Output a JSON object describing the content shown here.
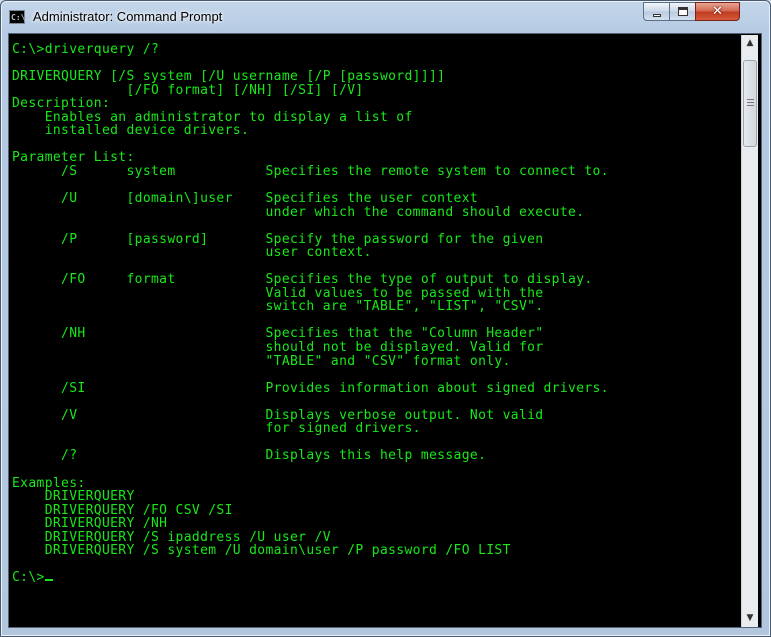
{
  "window": {
    "title": "Administrator: Command Prompt",
    "icon_name": "cmd-icon",
    "close_glyph": "✕"
  },
  "console": {
    "text_color": "#18e818",
    "background_color": "#000000",
    "lines": [
      "C:\\>driverquery /?",
      "",
      "DRIVERQUERY [/S system [/U username [/P [password]]]]",
      "              [/FO format] [/NH] [/SI] [/V]",
      "Description:",
      "    Enables an administrator to display a list of",
      "    installed device drivers.",
      "",
      "Parameter List:",
      "      /S      system           Specifies the remote system to connect to.",
      "",
      "      /U      [domain\\]user    Specifies the user context",
      "                               under which the command should execute.",
      "",
      "      /P      [password]       Specify the password for the given",
      "                               user context.",
      "",
      "      /FO     format           Specifies the type of output to display.",
      "                               Valid values to be passed with the",
      "                               switch are \"TABLE\", \"LIST\", \"CSV\".",
      "",
      "      /NH                      Specifies that the \"Column Header\"",
      "                               should not be displayed. Valid for",
      "                               \"TABLE\" and \"CSV\" format only.",
      "",
      "      /SI                      Provides information about signed drivers.",
      "",
      "      /V                       Displays verbose output. Not valid",
      "                               for signed drivers.",
      "",
      "      /?                       Displays this help message.",
      "",
      "Examples:",
      "    DRIVERQUERY",
      "    DRIVERQUERY /FO CSV /SI",
      "    DRIVERQUERY /NH",
      "    DRIVERQUERY /S ipaddress /U user /V",
      "    DRIVERQUERY /S system /U domain\\user /P password /FO LIST",
      ""
    ],
    "prompt": "C:\\>"
  },
  "scrollbar": {
    "up_arrow": "▲",
    "down_arrow": "▼"
  }
}
